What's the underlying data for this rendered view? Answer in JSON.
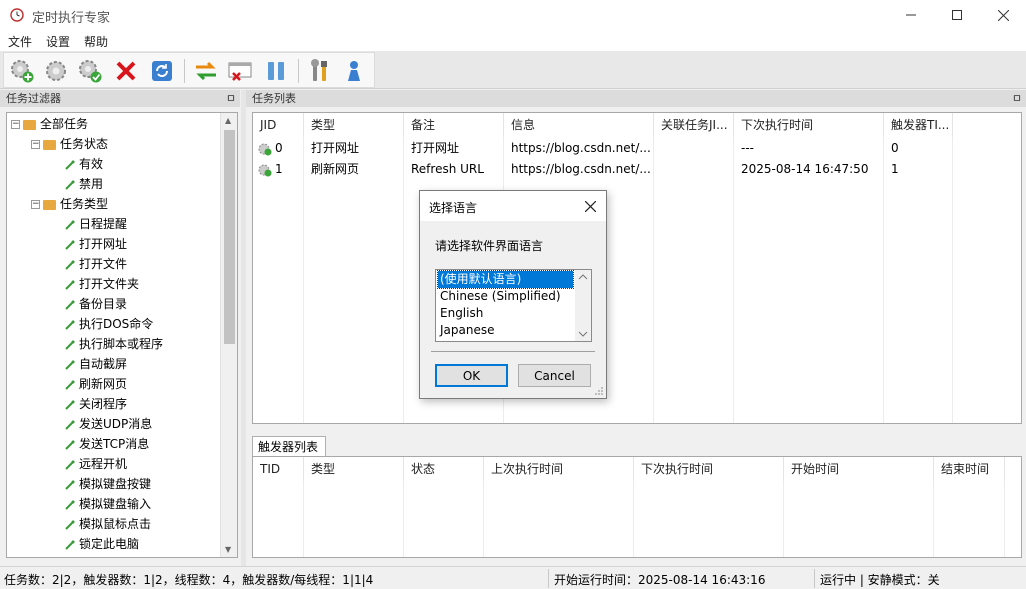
{
  "window": {
    "title": "定时执行专家",
    "minimize_icon": "minimize-icon",
    "maximize_icon": "maximize-icon",
    "close_icon": "close-icon"
  },
  "menu": [
    "文件",
    "设置",
    "帮助"
  ],
  "toolbar": {
    "icons": [
      "add-task-icon",
      "edit-task-icon",
      "enable-task-icon",
      "delete-icon",
      "refresh-icon",
      "swap-icon",
      "remove-window-icon",
      "pause-icon",
      "tools-icon",
      "user-icon"
    ]
  },
  "filter_panel": {
    "title": "任务过滤器",
    "pin": "ㅁ",
    "tree": {
      "root": "全部任务",
      "status_group": "任务状态",
      "status_items": [
        "有效",
        "禁用"
      ],
      "type_group": "任务类型",
      "type_items": [
        "日程提醒",
        "打开网址",
        "打开文件",
        "打开文件夹",
        "备份目录",
        "执行DOS命令",
        "执行脚本或程序",
        "自动截屏",
        "刷新网页",
        "关闭程序",
        "发送UDP消息",
        "发送TCP消息",
        "远程开机",
        "模拟键盘按键",
        "模拟键盘输入",
        "模拟鼠标点击",
        "锁定此电脑"
      ]
    }
  },
  "task_list": {
    "title": "任务列表",
    "pin": "ㅁ",
    "columns": [
      "JID",
      "类型",
      "备注",
      "信息",
      "关联任务JI...",
      "下次执行时间",
      "触发器TI..."
    ],
    "rows": [
      [
        "0",
        "打开网址",
        "打开网址",
        "https://blog.csdn.net/...",
        "",
        "---",
        "0"
      ],
      [
        "1",
        "刷新网页",
        "Refresh URL",
        "https://blog.csdn.net/...",
        "",
        "2025-08-14 16:47:50",
        "1"
      ]
    ]
  },
  "trigger_list": {
    "tab": "触发器列表",
    "columns": [
      "TID",
      "类型",
      "状态",
      "上次执行时间",
      "下次执行时间",
      "开始时间",
      "结束时间"
    ]
  },
  "status": {
    "counts": "任务数：2|2，触发器数：1|2，线程数：4，触发器数/每线程：1|1|4",
    "start_time": "开始运行时间：2025-08-14 16:43:16",
    "mode": "运行中 | 安静模式：关"
  },
  "dialog": {
    "title": "选择语言",
    "prompt": "请选择软件界面语言",
    "options": [
      "(使用默认语言)",
      "Chinese (Simplified)",
      "English",
      "Japanese"
    ],
    "selected": "(使用默认语言)",
    "ok": "OK",
    "cancel": "Cancel"
  },
  "colors": {
    "selection": "#0078d7",
    "folder": "#e8a840"
  }
}
